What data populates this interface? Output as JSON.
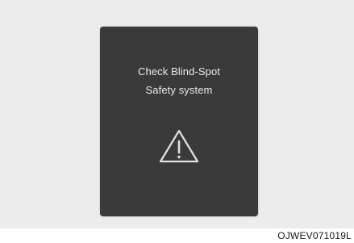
{
  "warning": {
    "line1": "Check Blind-Spot",
    "line2": "Safety system",
    "icon": "warning-triangle-icon"
  },
  "caption": "OJWEV071019L",
  "colors": {
    "background": "#ececec",
    "panel": "#3a3a3a",
    "text": "#e9e9e9"
  }
}
